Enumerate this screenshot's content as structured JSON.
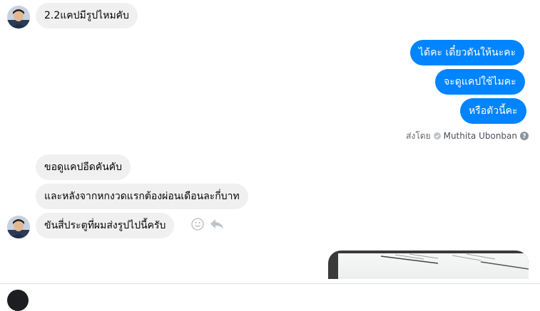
{
  "messages": [
    {
      "id": "m1",
      "side": "in",
      "text": "2.2แคปมีรูปไหมคับ"
    },
    {
      "id": "m2",
      "side": "out",
      "text": "ได้คะ เดี๋ยวดันให้นะคะ"
    },
    {
      "id": "m3",
      "side": "out",
      "text": "จะดูแคปใช้ไมคะ"
    },
    {
      "id": "m4",
      "side": "out",
      "text": "หรือตัวนี้คะ"
    },
    {
      "id": "m5",
      "side": "in",
      "text": "ขอดูแคปอีดคันคับ"
    },
    {
      "id": "m6",
      "side": "in",
      "text": "และหลังจากหกงวดแรกต้องผ่อนเดือนละกี่บาท"
    },
    {
      "id": "m7",
      "side": "in",
      "text": "ขันสี่ประตูที่ผมส่งรูปไปนี้ครับ"
    }
  ],
  "sent_by": {
    "label": "ส่งโดย",
    "name": "Muthita Ubonban"
  },
  "icons": {
    "emoji": "smiley-icon",
    "reply": "reply-arrow-icon",
    "seen_check": "check-circle-icon",
    "help": "question-circle-icon"
  },
  "colors": {
    "outgoing": "#0084ff",
    "incoming": "#f0f0f0"
  }
}
